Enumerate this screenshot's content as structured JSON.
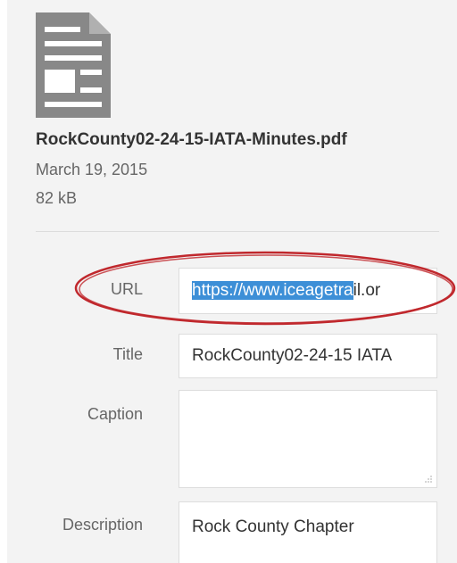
{
  "attachment": {
    "icon": "document-icon",
    "filename": "RockCounty02-24-15-IATA-Minutes.pdf",
    "date": "March 19, 2015",
    "size": "82 kB"
  },
  "fields": {
    "url": {
      "label": "URL",
      "value_selected": "https://www.iceagetra",
      "value_rest": "il.or"
    },
    "title": {
      "label": "Title",
      "value": "RockCounty02-24-15 IATA"
    },
    "caption": {
      "label": "Caption",
      "value": ""
    },
    "description": {
      "label": "Description",
      "value": "Rock County Chapter"
    }
  },
  "colors": {
    "panel_background": "#f3f3f3",
    "selection_highlight": "#3d8fd7",
    "annotation_circle": "#c0282d",
    "icon_gray": "#888888"
  }
}
